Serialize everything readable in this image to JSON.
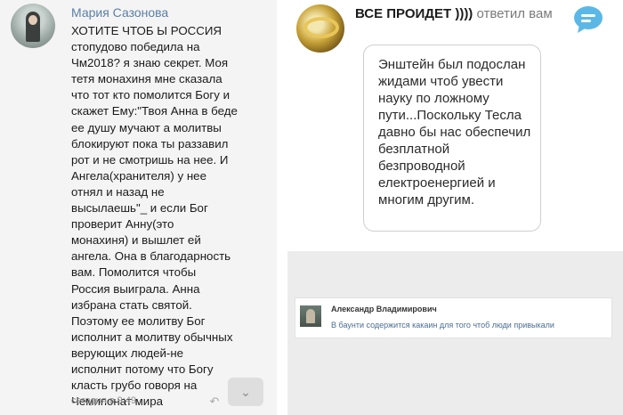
{
  "left_post": {
    "author": "Мария Сазонова",
    "text": "ХОТИТЕ ЧТОБ Ы РОССИЯ\nстопудово победила на\nЧм2018? я знаю секрет. Моя\nтетя монахиня мне сказала\nчто тот кто помолится Богу и\nскажет Ему:\"Твоя Анна в беде\nее душу мучают а молитвы\nблокируют пока ты раззавил\nрот и не смотришь на нее. И\nАнгела(хранителя) у нее\nотнял и назад не\nвысылаешь\"_ и если Бог\nпроверит Анну(это\nмонахиня) и вышлет ей\nангела. Она в благодарность\nвам. Помолится чтобы\nРоссия выиграла. Анна\nизбрана стать святой.\nПоэтому ее молитву Бог\nисполнит а молитву обычных\nверующих людей-не\nисполнит потому что Богу\nкласть грубо говоря на\nЧемипонат мира",
    "timestamp": "сегодня в 9:49",
    "icons": {
      "reply": "reply-arrow-icon",
      "scroll": "chevron-down-icon"
    }
  },
  "right_post": {
    "author": "ВСЕ ПРОИДЕТ ))))",
    "action": "ответил вам",
    "quote": "Энштейн был подослан\nжидами чтоб увести\nнауку по ложному\nпути...Поскольку Тесла\nдавно бы нас обеспечил\nбезплатной\nбезпроводной\nелектроенергией и\nмногим другим.",
    "icons": {
      "message": "speech-bubble-icon"
    },
    "colors": {
      "bubble": "#5bb8e6"
    }
  },
  "comment": {
    "author": "Александр Владимирович",
    "text": "В баунти содержится какаин для того чтоб люди привыкали"
  }
}
